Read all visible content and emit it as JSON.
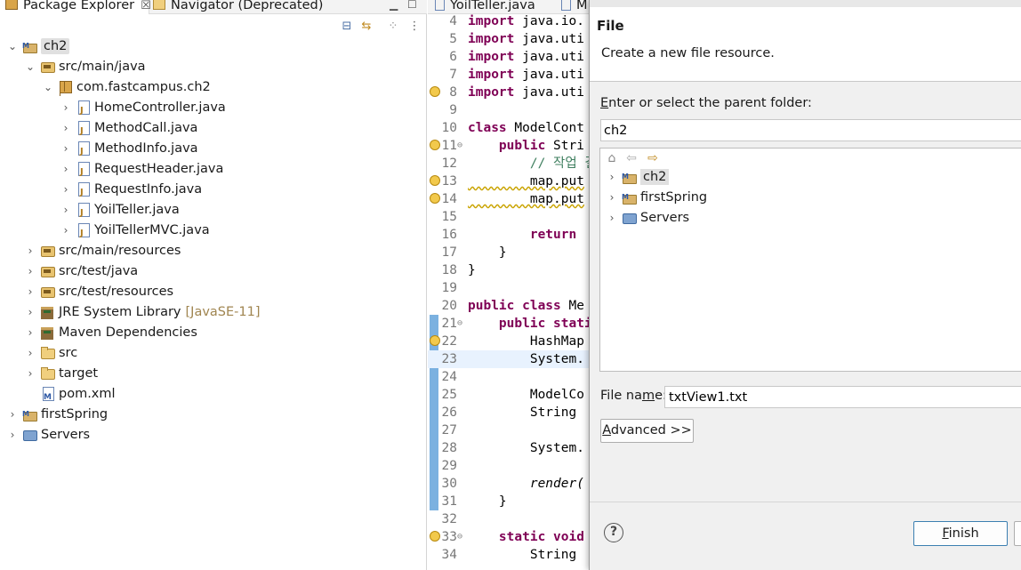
{
  "explorer": {
    "tabs": [
      {
        "label": "Package Explorer",
        "close": "☒"
      },
      {
        "label": "Navigator (Deprecated)"
      }
    ],
    "tree": [
      {
        "label": "ch2",
        "icon": "project-icon",
        "depth": 0,
        "expanded": true,
        "selected": true
      },
      {
        "label": "src/main/java",
        "icon": "source-folder-icon",
        "depth": 1,
        "expanded": true
      },
      {
        "label": "com.fastcampus.ch2",
        "icon": "package-icon",
        "depth": 2,
        "expanded": true
      },
      {
        "label": "HomeController.java",
        "icon": "java-file-icon",
        "depth": 3,
        "expanded": false
      },
      {
        "label": "MethodCall.java",
        "icon": "java-file-icon",
        "depth": 3,
        "expanded": false
      },
      {
        "label": "MethodInfo.java",
        "icon": "java-file-icon",
        "depth": 3,
        "expanded": false
      },
      {
        "label": "RequestHeader.java",
        "icon": "java-file-icon",
        "depth": 3,
        "expanded": false
      },
      {
        "label": "RequestInfo.java",
        "icon": "java-file-icon",
        "depth": 3,
        "expanded": false
      },
      {
        "label": "YoilTeller.java",
        "icon": "java-file-icon",
        "depth": 3,
        "expanded": false
      },
      {
        "label": "YoilTellerMVC.java",
        "icon": "java-file-icon",
        "depth": 3,
        "expanded": false
      },
      {
        "label": "src/main/resources",
        "icon": "source-folder-icon",
        "depth": 1,
        "expanded": false
      },
      {
        "label": "src/test/java",
        "icon": "source-folder-icon",
        "depth": 1,
        "expanded": false
      },
      {
        "label": "src/test/resources",
        "icon": "source-folder-icon",
        "depth": 1,
        "expanded": false
      },
      {
        "label": "JRE System Library",
        "suffix": "[JavaSE-11]",
        "icon": "library-icon",
        "depth": 1,
        "expanded": false
      },
      {
        "label": "Maven Dependencies",
        "icon": "library-icon",
        "depth": 1,
        "expanded": false
      },
      {
        "label": "src",
        "icon": "folder-icon",
        "depth": 1,
        "expanded": false
      },
      {
        "label": "target",
        "icon": "folder-icon",
        "depth": 1,
        "expanded": false
      },
      {
        "label": "pom.xml",
        "icon": "xml-file-icon",
        "depth": 1,
        "leaf": true
      },
      {
        "label": "firstSpring",
        "icon": "project-icon",
        "depth": 0,
        "expanded": false
      },
      {
        "label": "Servers",
        "icon": "server-folder-icon",
        "depth": 0,
        "expanded": false
      }
    ]
  },
  "editor": {
    "tabs": [
      {
        "label": "YoilTeller.java"
      },
      {
        "label": "M"
      }
    ],
    "lines": [
      {
        "n": "4",
        "kw": "import",
        "rest": " java.io."
      },
      {
        "n": "5",
        "kw": "import",
        "rest": " java.uti"
      },
      {
        "n": "6",
        "kw": "import",
        "rest": " java.uti"
      },
      {
        "n": "7",
        "kw": "import",
        "rest": " java.uti"
      },
      {
        "n": "8",
        "kw": "import",
        "rest": " java.uti",
        "marker": true
      },
      {
        "n": "9",
        "kw": "",
        "rest": ""
      },
      {
        "n": "10",
        "kw": "class",
        "rest": " ModelCont"
      },
      {
        "n": "11",
        "kw": "    public",
        "rest": " Stri",
        "marker": true,
        "fold": true
      },
      {
        "n": "12",
        "kw": "",
        "rest": "",
        "comment": "        // 작업 결"
      },
      {
        "n": "13",
        "kw": "",
        "rest": "        map.put",
        "marker": true
      },
      {
        "n": "14",
        "kw": "",
        "rest": "        map.put",
        "marker": true
      },
      {
        "n": "15",
        "kw": "",
        "rest": ""
      },
      {
        "n": "16",
        "kw": "        return",
        "rest": " "
      },
      {
        "n": "17",
        "kw": "",
        "rest": "    }"
      },
      {
        "n": "18",
        "kw": "",
        "rest": "}"
      },
      {
        "n": "19",
        "kw": "",
        "rest": ""
      },
      {
        "n": "20",
        "kw": "public class",
        "rest": " Me"
      },
      {
        "n": "21",
        "kw": "    public stati",
        "rest": "",
        "fold": true
      },
      {
        "n": "22",
        "kw": "",
        "rest": "        HashMap",
        "marker": true
      },
      {
        "n": "23",
        "kw": "",
        "rest": "        System.",
        "highlight": true
      },
      {
        "n": "24",
        "kw": "",
        "rest": ""
      },
      {
        "n": "25",
        "kw": "",
        "rest": "        ModelCo"
      },
      {
        "n": "26",
        "kw": "",
        "rest": "        String "
      },
      {
        "n": "27",
        "kw": "",
        "rest": ""
      },
      {
        "n": "28",
        "kw": "",
        "rest": "        System."
      },
      {
        "n": "29",
        "kw": "",
        "rest": ""
      },
      {
        "n": "30",
        "kw": "",
        "rest": "        render(",
        "italic": true
      },
      {
        "n": "31",
        "kw": "",
        "rest": "    }"
      },
      {
        "n": "32",
        "kw": "",
        "rest": ""
      },
      {
        "n": "33",
        "kw": "    static void",
        "rest": "",
        "marker": true,
        "fold": true
      },
      {
        "n": "34",
        "kw": "",
        "rest": "        String "
      }
    ]
  },
  "dialog": {
    "title": "File",
    "description": "Create a new file resource.",
    "parent_label": "Enter or select the parent folder:",
    "parent_value": "ch2",
    "folders": [
      {
        "label": "ch2",
        "icon": "project-icon",
        "selected": true
      },
      {
        "label": "firstSpring",
        "icon": "project-icon"
      },
      {
        "label": "Servers",
        "icon": "server-folder-icon"
      }
    ],
    "filename_label_pre": "File na",
    "filename_label_mn": "m",
    "filename_label_post": "e:",
    "filename_value": "txtView1.txt",
    "advanced_label_mn": "A",
    "advanced_label_rest": "dvanced >>",
    "finish_label_mn": "F",
    "finish_label_rest": "inish",
    "help": "?"
  }
}
